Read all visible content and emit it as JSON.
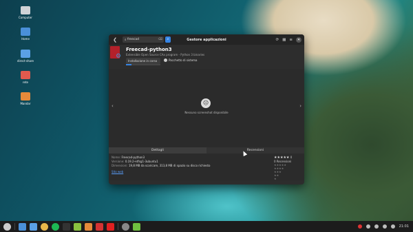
{
  "desktop": {
    "icons": [
      {
        "label": "Computer",
        "icon": "computer-icon",
        "color": "#cfd2d6"
      },
      {
        "label": "Home",
        "icon": "home-folder-icon",
        "color": "#4a90d9"
      },
      {
        "label": "direct-share",
        "icon": "folder-icon",
        "color": "#5aa0e6"
      },
      {
        "label": "rete",
        "icon": "folder-icon",
        "color": "#e05a4e"
      },
      {
        "label": "Mandar",
        "icon": "folder-icon",
        "color": "#e58a3a"
      }
    ]
  },
  "window": {
    "title": "Gestore applicazioni",
    "search": {
      "value": "freecad",
      "clear_icon": "clear-icon",
      "go_icon": "search-icon"
    },
    "titlebar_icons": [
      "refresh-icon",
      "grid-icon",
      "menu-icon",
      "close-icon"
    ],
    "app": {
      "name": "Freecad-python3",
      "subtitle": "Extensible Open Source CAx program - Python 3 binaries",
      "install_label": "Installazione in corso",
      "install_progress": 0.15,
      "system_package_label": "Pacchetto di sistema"
    },
    "screenshots": {
      "empty_icon": "sad-face-icon",
      "empty_text": "Nessuno screenshot disponibile",
      "prev_icon": "chevron-left-icon",
      "next_icon": "chevron-right-icon"
    },
    "tabs": [
      {
        "label": "Dettagli",
        "active": true
      },
      {
        "label": "Recensioni",
        "active": false
      }
    ],
    "details": [
      {
        "key": "Nome:",
        "value": "Freecad-python3"
      },
      {
        "key": "Versione:",
        "value": "0.19.2+dfsg1-3ubuntu1"
      },
      {
        "key": "Dimensioni:",
        "value": "19,8 MB da scaricare, 313,8 MB di spazio su disco richiesto"
      }
    ],
    "details_link": "Sito web",
    "ratings": {
      "stars": "★★★★★",
      "score": "0",
      "count_label": "0 Recensioni"
    }
  },
  "taskbar": {
    "apps": [
      {
        "icon": "menu-icon",
        "color": "#cccccc"
      },
      {
        "icon": "files-icon",
        "color": "#4a90d9"
      },
      {
        "icon": "folder-icon",
        "color": "#5aa0e6"
      },
      {
        "icon": "browser-icon",
        "color": "#e8b84a"
      },
      {
        "icon": "spotify-icon",
        "color": "#1db954"
      },
      {
        "icon": "terminal-icon",
        "color": "#333333"
      },
      {
        "icon": "package-icon",
        "color": "#8ac13f"
      },
      {
        "icon": "app-icon",
        "color": "#e58a3a"
      },
      {
        "icon": "app-icon",
        "color": "#d33333"
      },
      {
        "icon": "youtube-icon",
        "color": "#e02020"
      },
      {
        "icon": "timer-icon",
        "color": "#888888"
      },
      {
        "icon": "store-icon",
        "color": "#6fbf3f"
      }
    ],
    "clock": "21:01"
  },
  "colors": {
    "accent": "#3584e4",
    "window_bg": "#2d2d2d",
    "taskbar_bg": "#1c1c1c"
  }
}
